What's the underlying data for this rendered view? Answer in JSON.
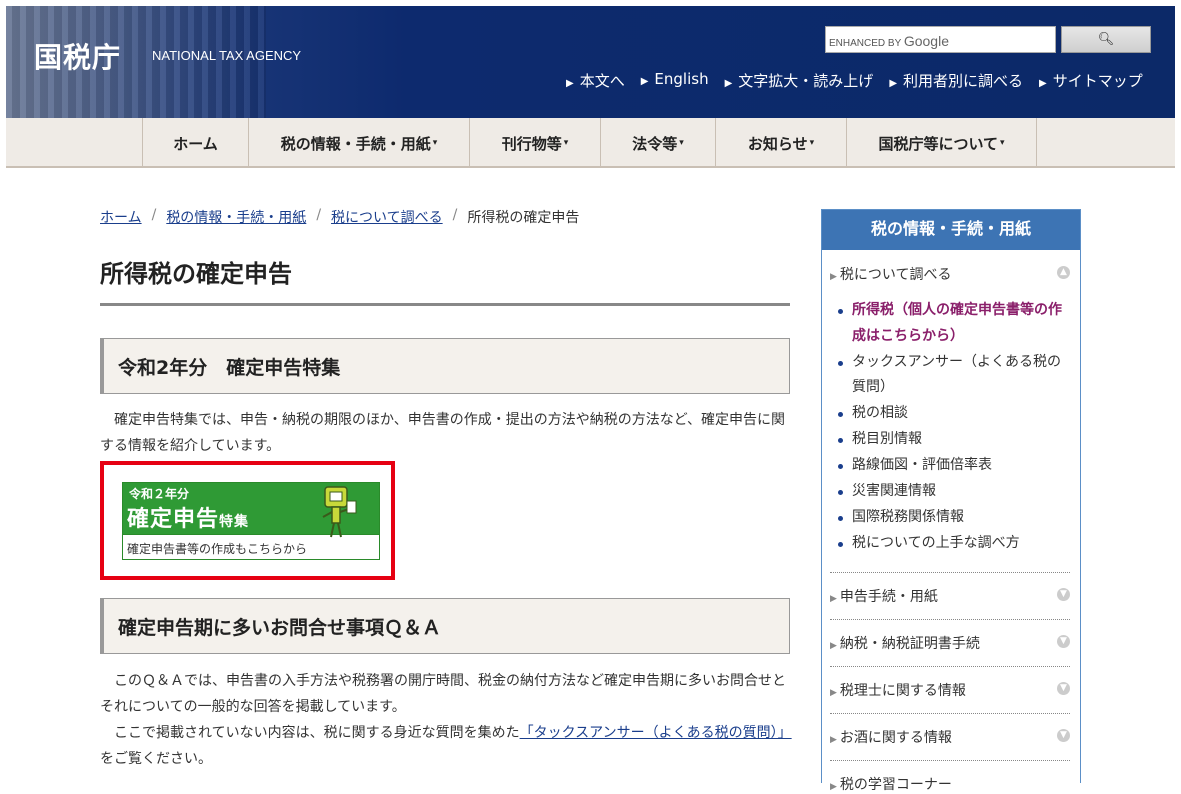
{
  "header": {
    "site_title": "国税庁",
    "site_title_en": "NATIONAL TAX AGENCY",
    "search_enhanced_by": "ENHANCED BY",
    "search_google": "Google",
    "search_button_icon": "search-icon",
    "util_nav": [
      "本文へ",
      "English",
      "文字拡大・読み上げ",
      "利用者別に調べる",
      "サイトマップ"
    ]
  },
  "gnav": {
    "items": [
      {
        "label": "ホーム",
        "has_menu": false
      },
      {
        "label": "税の情報・手続・用紙",
        "has_menu": true
      },
      {
        "label": "刊行物等",
        "has_menu": true
      },
      {
        "label": "法令等",
        "has_menu": true
      },
      {
        "label": "お知らせ",
        "has_menu": true
      },
      {
        "label": "国税庁等について",
        "has_menu": true
      }
    ],
    "caret": "▾"
  },
  "breadcrumb": {
    "items": [
      "ホーム",
      "税の情報・手続・用紙",
      "税について調べる"
    ],
    "current": "所得税の確定申告",
    "separator": "/"
  },
  "main": {
    "page_title": "所得税の確定申告",
    "section1": {
      "heading": "令和2年分　確定申告特集",
      "text": "　確定申告特集では、申告・納税の期限のほか、申告書の作成・提出の方法や納税の方法など、確定申告に関する情報を紹介しています。"
    },
    "banner": {
      "top": "令和２年分",
      "main": "確定申告",
      "main_small": "特集",
      "bottom": "確定申告書等の作成もこちらから"
    },
    "section2": {
      "heading": "確定申告期に多いお問合せ事項Ｑ＆Ａ",
      "text1": "　このＱ＆Ａでは、申告書の入手方法や税務署の開庁時間、税金の納付方法など確定申告期に多いお問合せとそれについての一般的な回答を掲載しています。",
      "text2_pre": "　ここで掲載されていない内容は、税に関する身近な質問を集めた",
      "text2_link": "「タックスアンサー（よくある税の質問）」",
      "text2_post": "をご覧ください。"
    }
  },
  "sidebar": {
    "heading": "税の情報・手続・用紙",
    "category_open": "税について調べる",
    "sub_items": [
      "所得税（個人の確定申告書等の作成はこちらから）",
      "タックスアンサー（よくある税の質問）",
      "税の相談",
      "税目別情報",
      "路線価図・評価倍率表",
      "災害関連情報",
      "国際税務関係情報",
      "税についての上手な調べ方"
    ],
    "categories": [
      "申告手続・用紙",
      "納税・納税証明書手続",
      "税理士に関する情報",
      "お酒に関する情報",
      "税の学習コーナー"
    ],
    "toggle_icon": "chevron-circle-icon"
  },
  "colors": {
    "header_bg": "#0c2968",
    "sidebar_accent": "#3d74b4",
    "highlight_frame": "#e60012",
    "current_item": "#8a1f6a"
  }
}
